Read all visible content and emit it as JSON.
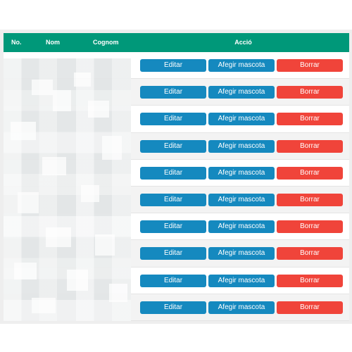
{
  "header": {
    "col_no": "No.",
    "col_nom": "Nom",
    "col_cognom": "Cognom",
    "col_accio": "Acció"
  },
  "actions": {
    "edit_label": "Editar",
    "add_pet_label": "Afegir mascota",
    "delete_label": "Borrar"
  },
  "rows": [
    {
      "no": "",
      "nom": "",
      "cognom": ""
    },
    {
      "no": "",
      "nom": "",
      "cognom": ""
    },
    {
      "no": "",
      "nom": "",
      "cognom": ""
    },
    {
      "no": "",
      "nom": "",
      "cognom": ""
    },
    {
      "no": "",
      "nom": "",
      "cognom": ""
    },
    {
      "no": "",
      "nom": "",
      "cognom": ""
    },
    {
      "no": "",
      "nom": "",
      "cognom": ""
    },
    {
      "no": "",
      "nom": "",
      "cognom": ""
    },
    {
      "no": "",
      "nom": "",
      "cognom": ""
    },
    {
      "no": "",
      "nom": "",
      "cognom": ""
    }
  ],
  "colors": {
    "header_bg": "#009879",
    "edit_button": "#1589bf",
    "add_pet_button": "#1589bf",
    "delete_button": "#f0443a"
  }
}
